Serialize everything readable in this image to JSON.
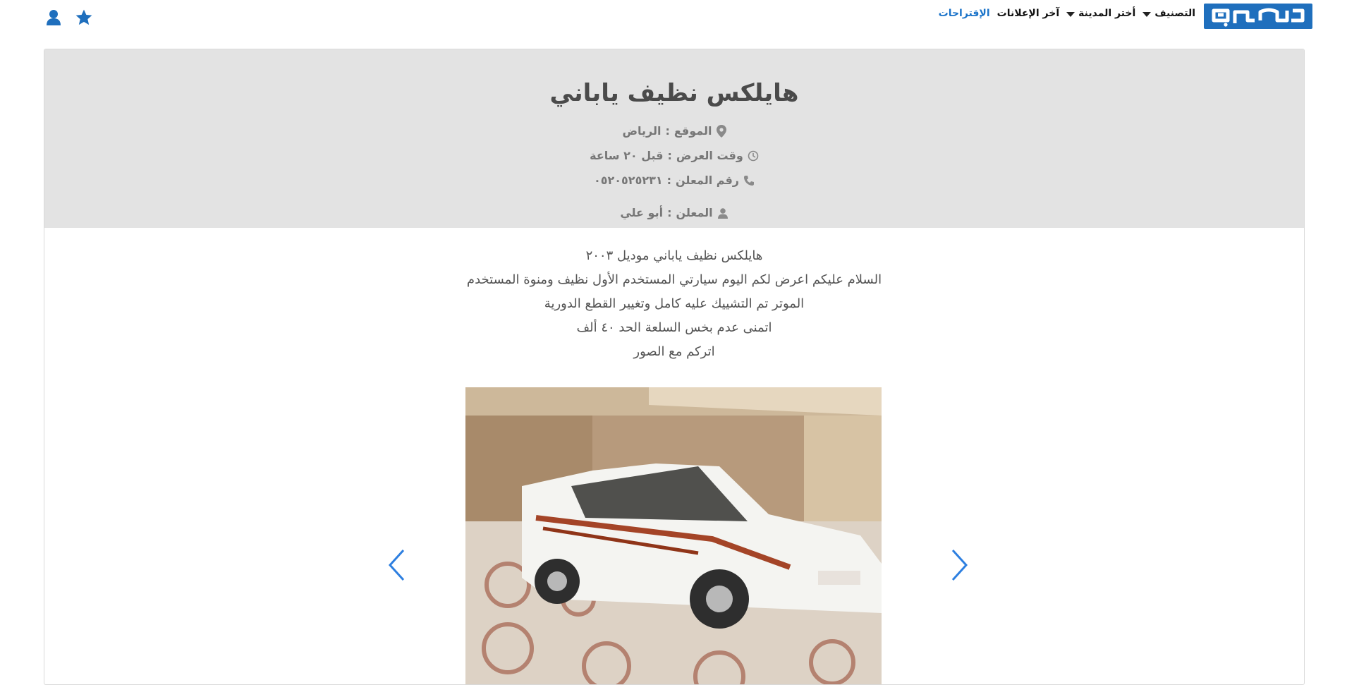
{
  "header": {
    "logo_text": "حراج",
    "nav": [
      {
        "label": "التصنيف"
      },
      {
        "label": "أختر المدينة"
      },
      {
        "label": "آخر الإعلانات"
      },
      {
        "label": "الإقتراحات"
      }
    ],
    "icons": [
      "star-icon",
      "user-icon"
    ]
  },
  "listing": {
    "title": "هايلكس نظيف ياباني",
    "location_label": "الموقع",
    "location_value": "الرياض",
    "time_label": "وقت العرض",
    "time_value": "قبل ٢٠ ساعة",
    "phone_label": "رقم المعلن",
    "phone_value": "٠٥٢٠٥٢٥٢٣١",
    "advertiser_label": "المعلن",
    "advertiser_value": "أبو علي",
    "description": [
      "هايلكس نظيف ياباني موديل ٢٠٠٣",
      "السلام عليكم اعرض لكم اليوم سيارتي المستخدم الأول نظيف ومنوة المستخدم",
      "الموتر تم التشييك عليه كامل وتغيير القطع الدورية",
      "اتمنى عدم بخس السلعة الحد ٤٠ ألف",
      "اتركم مع الصور"
    ]
  },
  "colors": {
    "brand": "#1f6fbd",
    "link": "#1a73c9",
    "header_bg": "#e3e3e3",
    "arrow": "#2d7fe0"
  }
}
